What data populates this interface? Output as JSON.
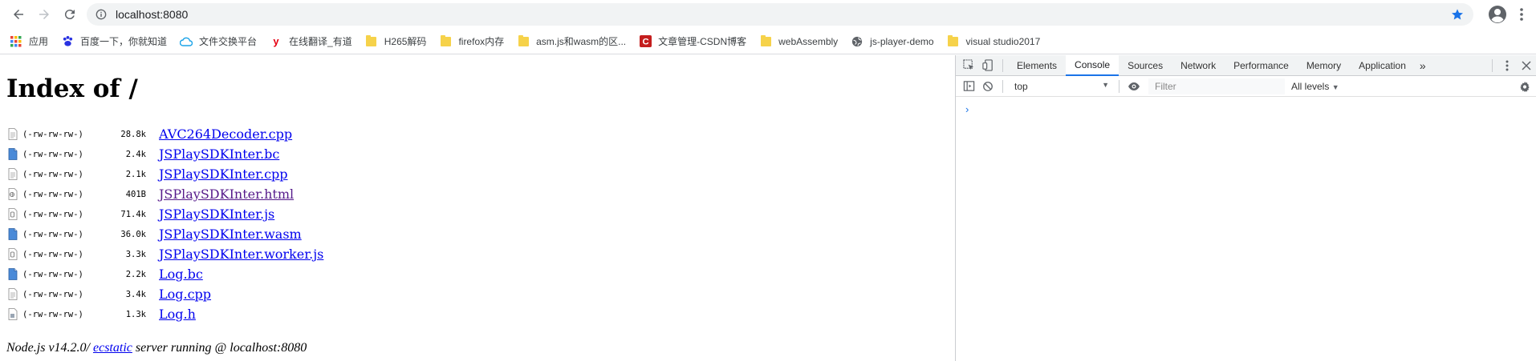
{
  "browser": {
    "url": "localhost:8080",
    "bookmarks": [
      {
        "label": "应用",
        "icon": "apps-grid-icon"
      },
      {
        "label": "百度一下，你就知道",
        "icon": "baidu-icon"
      },
      {
        "label": "文件交换平台",
        "icon": "cloud-icon"
      },
      {
        "label": "在线翻译_有道",
        "icon": "youdao-icon"
      },
      {
        "label": "H265解码",
        "icon": "folder-icon"
      },
      {
        "label": "firefox内存",
        "icon": "folder-icon"
      },
      {
        "label": "asm.js和wasm的区...",
        "icon": "folder-icon"
      },
      {
        "label": "文章管理-CSDN博客",
        "icon": "csdn-icon"
      },
      {
        "label": "webAssembly",
        "icon": "folder-icon"
      },
      {
        "label": "js-player-demo",
        "icon": "globe-icon"
      },
      {
        "label": "visual studio2017",
        "icon": "folder-icon"
      }
    ]
  },
  "page": {
    "title": "Index of /",
    "files": [
      {
        "perm": "(-rw-rw-rw-)",
        "size": "28.8k",
        "name": "AVC264Decoder.cpp",
        "visited": false,
        "icon": "text-file-icon"
      },
      {
        "perm": "(-rw-rw-rw-)",
        "size": "2.4k",
        "name": "JSPlaySDKInter.bc",
        "visited": false,
        "icon": "binary-file-icon"
      },
      {
        "perm": "(-rw-rw-rw-)",
        "size": "2.1k",
        "name": "JSPlaySDKInter.cpp",
        "visited": false,
        "icon": "text-file-icon"
      },
      {
        "perm": "(-rw-rw-rw-)",
        "size": "401B",
        "name": "JSPlaySDKInter.html",
        "visited": true,
        "icon": "html-file-icon"
      },
      {
        "perm": "(-rw-rw-rw-)",
        "size": "71.4k",
        "name": "JSPlaySDKInter.js",
        "visited": false,
        "icon": "script-file-icon"
      },
      {
        "perm": "(-rw-rw-rw-)",
        "size": "36.0k",
        "name": "JSPlaySDKInter.wasm",
        "visited": false,
        "icon": "binary-file-icon"
      },
      {
        "perm": "(-rw-rw-rw-)",
        "size": "3.3k",
        "name": "JSPlaySDKInter.worker.js",
        "visited": false,
        "icon": "script-file-icon"
      },
      {
        "perm": "(-rw-rw-rw-)",
        "size": "2.2k",
        "name": "Log.bc",
        "visited": false,
        "icon": "binary-file-icon"
      },
      {
        "perm": "(-rw-rw-rw-)",
        "size": "3.4k",
        "name": "Log.cpp",
        "visited": false,
        "icon": "text-file-icon"
      },
      {
        "perm": "(-rw-rw-rw-)",
        "size": "1.3k",
        "name": "Log.h",
        "visited": false,
        "icon": "header-file-icon"
      }
    ],
    "footer": {
      "prefix": "Node.js v14.2.0/ ",
      "link": "ecstatic",
      "suffix": " server running @ localhost:8080"
    }
  },
  "devtools": {
    "tabs": [
      "Elements",
      "Console",
      "Sources",
      "Network",
      "Performance",
      "Memory",
      "Application"
    ],
    "active_tab": "Console",
    "more": "»",
    "context": "top",
    "filter_placeholder": "Filter",
    "levels": "All levels",
    "prompt": "›"
  }
}
